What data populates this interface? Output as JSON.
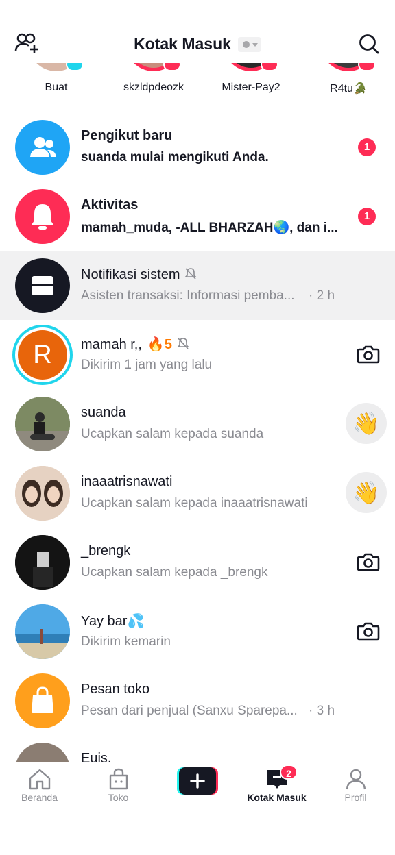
{
  "header": {
    "title": "Kotak Masuk",
    "left_icon": "add-friends-icon",
    "right_icon": "search-icon"
  },
  "stories": [
    {
      "name": "Buat",
      "badge": "plus"
    },
    {
      "name": "skzldpdeozk",
      "badge": "live"
    },
    {
      "name": "Mister-Pay2",
      "badge": "live"
    },
    {
      "name": "R4tu🐊",
      "badge": "live"
    }
  ],
  "inbox": {
    "new_followers": {
      "title": "Pengikut baru",
      "subtitle": "suanda mulai mengikuti Anda.",
      "count": "1",
      "icon": "people-icon",
      "color": "#1fa5f5"
    },
    "activity": {
      "title": "Aktivitas",
      "subtitle": "mamah_muda, -ALL BHARZAH🌏, dan i...",
      "count": "1",
      "icon": "bell-icon",
      "color": "#fe2c55"
    },
    "system": {
      "title": "Notifikasi sistem",
      "subtitle": "Asisten transaksi: Informasi pemba...",
      "time": "· 2 h",
      "icon": "inbox-tray-icon",
      "color": "#161823"
    },
    "chats": [
      {
        "name": "mamah r,,",
        "streak": "🔥5",
        "subtitle": "Dikirim 1 jam yang lalu",
        "action": "camera",
        "avatar_letter": "R"
      },
      {
        "name": "suanda",
        "subtitle": "Ucapkan salam kepada suanda",
        "action": "wave",
        "wave": "👋"
      },
      {
        "name": "inaaatrisnawati",
        "subtitle": "Ucapkan salam kepada inaaatrisnawati",
        "action": "wave",
        "wave": "👋"
      },
      {
        "name": "_brengk",
        "subtitle": "Ucapkan salam kepada _brengk",
        "action": "camera"
      },
      {
        "name": "Yay  bar💦",
        "subtitle": "Dikirim kemarin",
        "action": "camera"
      },
      {
        "name": "Pesan toko",
        "subtitle": "Pesan dari penjual (Sanxu Sparepa...",
        "time": "· 3 h",
        "icon": "shopping-bag-icon",
        "color": "#ff9f1c"
      },
      {
        "name": "Euis.",
        "subtitle": ""
      }
    ]
  },
  "bottom_nav": {
    "home": "Beranda",
    "shop": "Toko",
    "inbox": "Kotak Masuk",
    "inbox_badge": "2",
    "profile": "Profil"
  }
}
